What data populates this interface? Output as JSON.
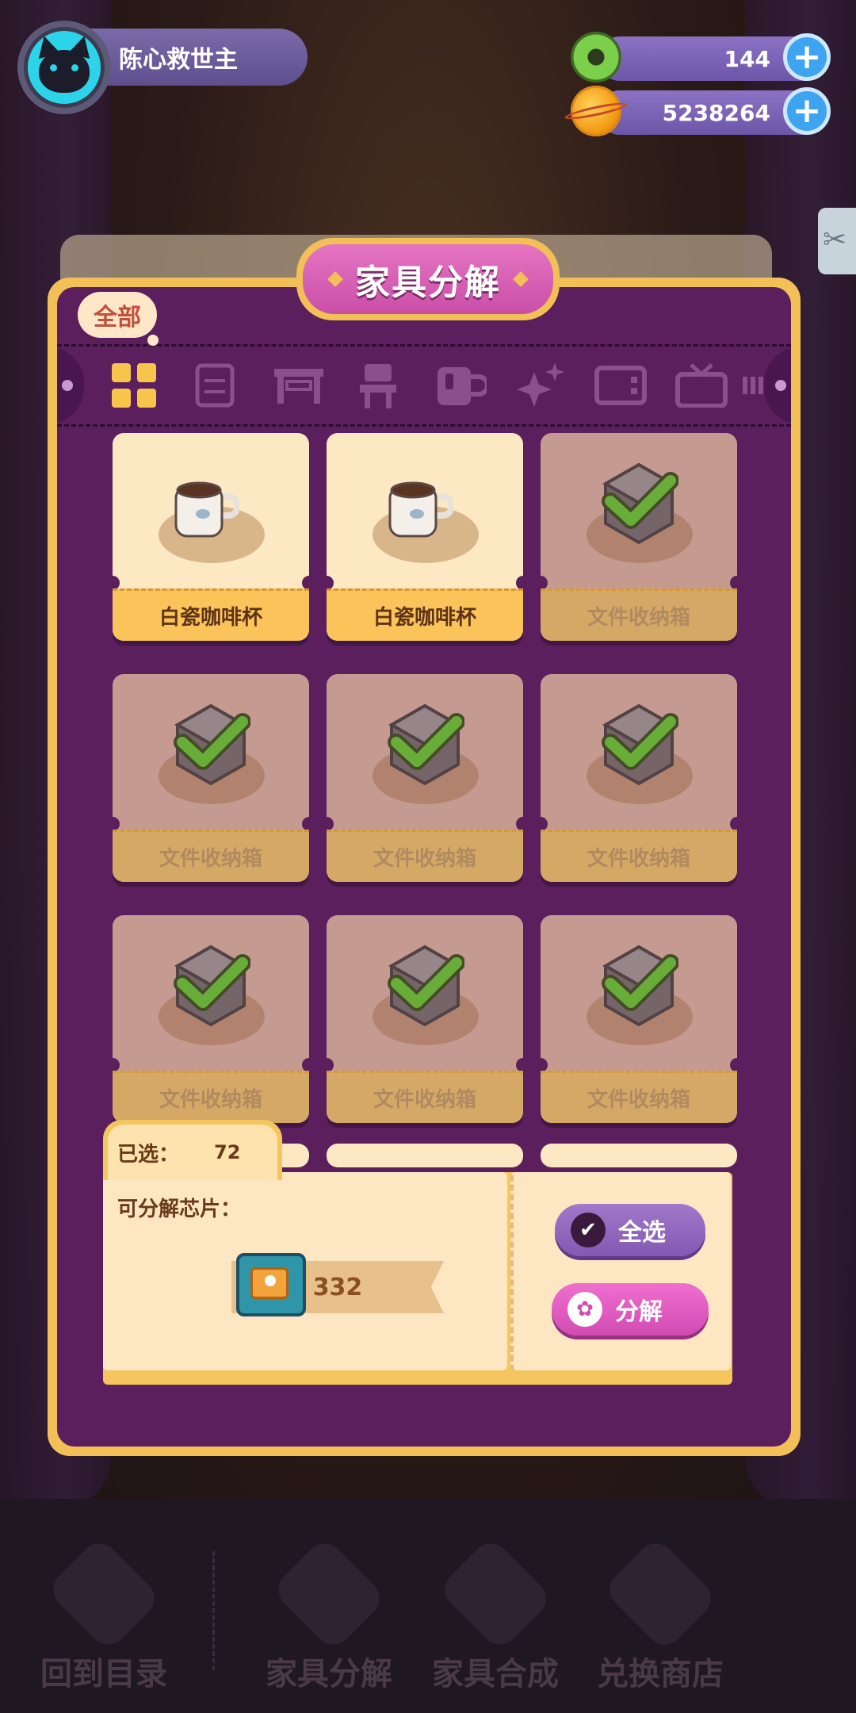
{
  "user": {
    "name": "陈心救世主",
    "avatar_icon": "cat-icon"
  },
  "currencies": [
    {
      "icon": "donut-coin-icon",
      "value": "144"
    },
    {
      "icon": "planet-coin-icon",
      "value": "5238264"
    }
  ],
  "panel": {
    "title": "家具分解",
    "filter_tag": "全部",
    "tabs": [
      "all-grid-icon",
      "cabinet-icon",
      "table-icon",
      "chair-icon",
      "mug-icon",
      "sparkle-icon",
      "tv-icon",
      "display-icon",
      "more-icon"
    ],
    "items": [
      {
        "name": "白瓷咖啡杯",
        "selected": false
      },
      {
        "name": "白瓷咖啡杯",
        "selected": false
      },
      {
        "name": "文件收纳箱",
        "selected": true
      },
      {
        "name": "文件收纳箱",
        "selected": true
      },
      {
        "name": "文件收纳箱",
        "selected": true
      },
      {
        "name": "文件收纳箱",
        "selected": true
      },
      {
        "name": "文件收纳箱",
        "selected": true
      },
      {
        "name": "文件收纳箱",
        "selected": true
      },
      {
        "name": "文件收纳箱",
        "selected": true
      }
    ],
    "selected_label": "已选：",
    "selected_count": "72",
    "chip_label": "可分解芯片：",
    "chip_value": "332",
    "select_all_label": "全选",
    "decompose_label": "分解"
  },
  "nav": [
    {
      "label": "回到目录",
      "icon": "back-book-icon"
    },
    {
      "label": "家具分解",
      "icon": "puzzle-icon"
    },
    {
      "label": "家具合成",
      "icon": "hammer-icon"
    },
    {
      "label": "兑换商店",
      "icon": "gift-icon"
    }
  ],
  "colors": {
    "panel_border": "#f2c057",
    "panel_bg": "#5a1f5c",
    "title_pink": "#d85bb3",
    "check_green": "#5bd12a"
  }
}
